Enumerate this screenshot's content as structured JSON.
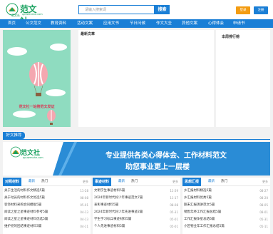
{
  "header": {
    "logo_text": "范文社",
    "logo_sub": "范文社",
    "logo_url": "qpuwenshe.com",
    "search_placeholder": "请输入搜索词",
    "search_button": "搜索",
    "login_label": "登录",
    "register_label": "注册"
  },
  "nav": {
    "items": [
      "首页",
      "公文范文",
      "教育资料",
      "活动文案",
      "应用文书",
      "节日问候",
      "作文大全",
      "其他文案",
      "心得体会",
      "申请书"
    ]
  },
  "hero": {
    "title": "范文社一站搜范文发证",
    "caption": ""
  },
  "latest": {
    "title": "最新文章"
  },
  "rank": {
    "title": "本周排行榜"
  },
  "recommend": {
    "label": "好文推荐"
  },
  "banner": {
    "logo_text": "范文社",
    "logo_url": "qpuwenshe.com",
    "line1": "专业提供各类心得体会、工作材料范文",
    "line2": "助您事业更上一层楼"
  },
  "columns": [
    {
      "tag": "对照材料",
      "tabs": [
        "最新",
        "热门"
      ],
      "more": "更多",
      "rows": [
        {
          "title": "关于生活的材料作文精选5篇",
          "date": "11-28"
        },
        {
          "title": "关于动员的材料作文优选5篇",
          "date": "08-08"
        },
        {
          "title": "装饰材料采购合同模板5篇",
          "date": "05-01"
        },
        {
          "title": "阅读之星之星事迹材料参考5篇",
          "date": "04-13"
        },
        {
          "title": "阅读之星之星事迹材料优选5篇",
          "date": "04-13"
        },
        {
          "title": "维护党的团结事迹材料3篇",
          "date": "04-11"
        }
      ]
    },
    {
      "tag": "事迹材料",
      "tabs": [
        "最新",
        "热门"
      ],
      "more": "更多",
      "rows": [
        {
          "title": "文明学生事迹材料5篇",
          "date": "11-29"
        },
        {
          "title": "2024年新时代好少年事迹范文7篇",
          "date": "11-17"
        },
        {
          "title": "表彰事迹材料5篇",
          "date": "08-08"
        },
        {
          "title": "2024年新时代好少年先进事迹2篇",
          "date": "05-31"
        },
        {
          "title": "学生学习标兵事迹材料5篇",
          "date": "05-01"
        },
        {
          "title": "个人先进事迹材料5篇",
          "date": "05-01"
        }
      ]
    },
    {
      "tag": "思想汇报",
      "tabs": [
        "最新",
        "热门"
      ],
      "more": "更多",
      "rows": [
        {
          "title": "乡汇报材料精选5篇",
          "date": "08-27"
        },
        {
          "title": "乡汇报材料优秀5篇",
          "date": "08-20"
        },
        {
          "title": "期末汇报演讲范文5篇",
          "date": "08-05"
        },
        {
          "title": "销售年终工作汇报总结5篇",
          "date": "08-01"
        },
        {
          "title": "工作汇报争星总结6篇",
          "date": "05-31"
        },
        {
          "title": "小区物业年工作汇报总结5篇",
          "date": "05-11"
        }
      ]
    }
  ]
}
